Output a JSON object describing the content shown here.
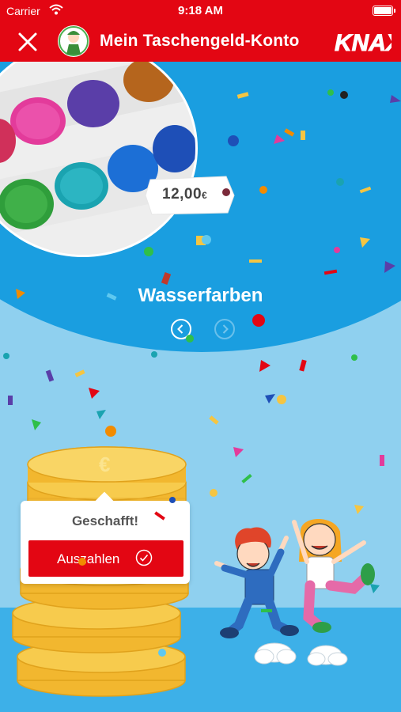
{
  "status_bar": {
    "carrier": "Carrier",
    "time": "9:18 AM"
  },
  "nav": {
    "title": "Mein Taschengeld-Konto",
    "logo_text": "KNAX"
  },
  "product": {
    "price": "12,00",
    "currency": "€",
    "name": "Wasserfarben"
  },
  "card": {
    "done_text": "Geschafft!",
    "button_label": "Auszahlen"
  },
  "icons": {
    "close": "close-icon",
    "avatar": "knax-character-avatar",
    "prev": "chevron-left-icon",
    "next": "chevron-right-icon",
    "check": "check-circle-icon",
    "wifi": "wifi-icon",
    "battery": "battery-icon"
  },
  "colors": {
    "brand_red": "#e30613",
    "sky_blue": "#8fd0ef",
    "hero_blue": "#1a9ee0",
    "coin_gold": "#f5c542"
  }
}
